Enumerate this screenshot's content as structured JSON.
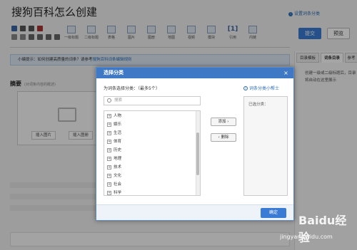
{
  "page": {
    "title": "搜狗百科怎么创建",
    "top_link": "设置词条分类"
  },
  "toolbar": {
    "buttons": [
      "一级标题",
      "二级标题",
      "表格",
      "图片",
      "图册",
      "地图",
      "视频",
      "模块",
      "引用",
      "内链"
    ],
    "ref_mark": "[1]",
    "submit": "提交",
    "preview": "预览"
  },
  "tip": {
    "text": "小编提示：如何创建高质量的词条？请参考",
    "link": "搜狗百科词条编辑规则"
  },
  "right_panel": {
    "tabs": [
      "目录模板",
      "词条目录",
      "参考"
    ],
    "text": "创建一级或二级标题后，目录将自动在这里展示"
  },
  "editor": {
    "summary_label": "摘要",
    "summary_hint": "(对词条内容的概述)",
    "insert_image": "插入图片",
    "insert_album": "插入图册"
  },
  "dialog": {
    "title": "选择分类",
    "select_label": "为词条选择分类：（最多5个）",
    "help_link": "词条分类小帮士",
    "search_placeholder": "搜索",
    "categories": [
      "人物",
      "娱乐",
      "生活",
      "体育",
      "历史",
      "地理",
      "技术",
      "文化",
      "社会",
      "科学"
    ],
    "add_button": "添加",
    "delete_button": "删除",
    "selected_label": "已选分类：",
    "ok_button": "确定"
  },
  "watermark": {
    "logo": "Baidu经验",
    "url": "jingyan.baidu.com"
  }
}
